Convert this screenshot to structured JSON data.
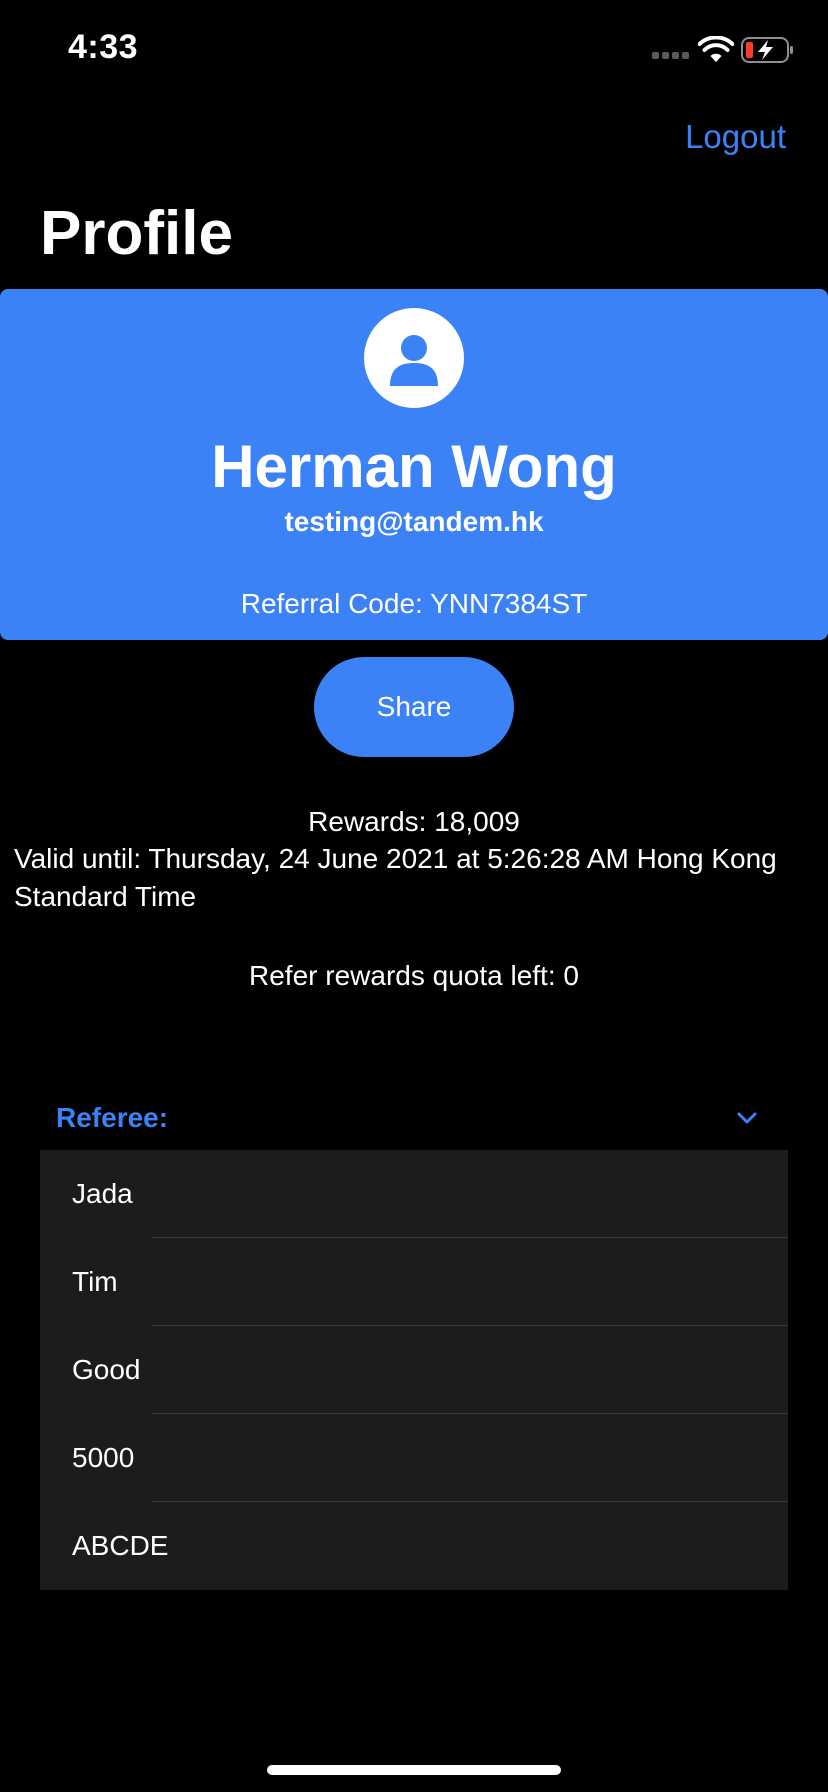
{
  "status_bar": {
    "time": "4:33",
    "battery_color": "#ff3b30"
  },
  "header": {
    "logout_label": "Logout",
    "page_title": "Profile"
  },
  "profile": {
    "avatar_icon": "person-icon",
    "name": "Herman Wong",
    "email": "testing@tandem.hk",
    "referral_code": "Referral Code: YNN7384ST"
  },
  "share_label": "Share",
  "rewards": {
    "points": "Rewards: 18,009",
    "valid_until": "Valid until: Thursday, 24 June 2021 at 5:26:28 AM Hong Kong Standard Time",
    "quota": "Refer rewards quota left: 0"
  },
  "referee": {
    "label": "Referee:",
    "expanded": true,
    "items": [
      "Jada",
      "Tim",
      "Good",
      "5000",
      "ABCDE"
    ]
  },
  "colors": {
    "accent": "#3b82f6",
    "background": "#000000",
    "list_bg": "#1c1c1e"
  }
}
